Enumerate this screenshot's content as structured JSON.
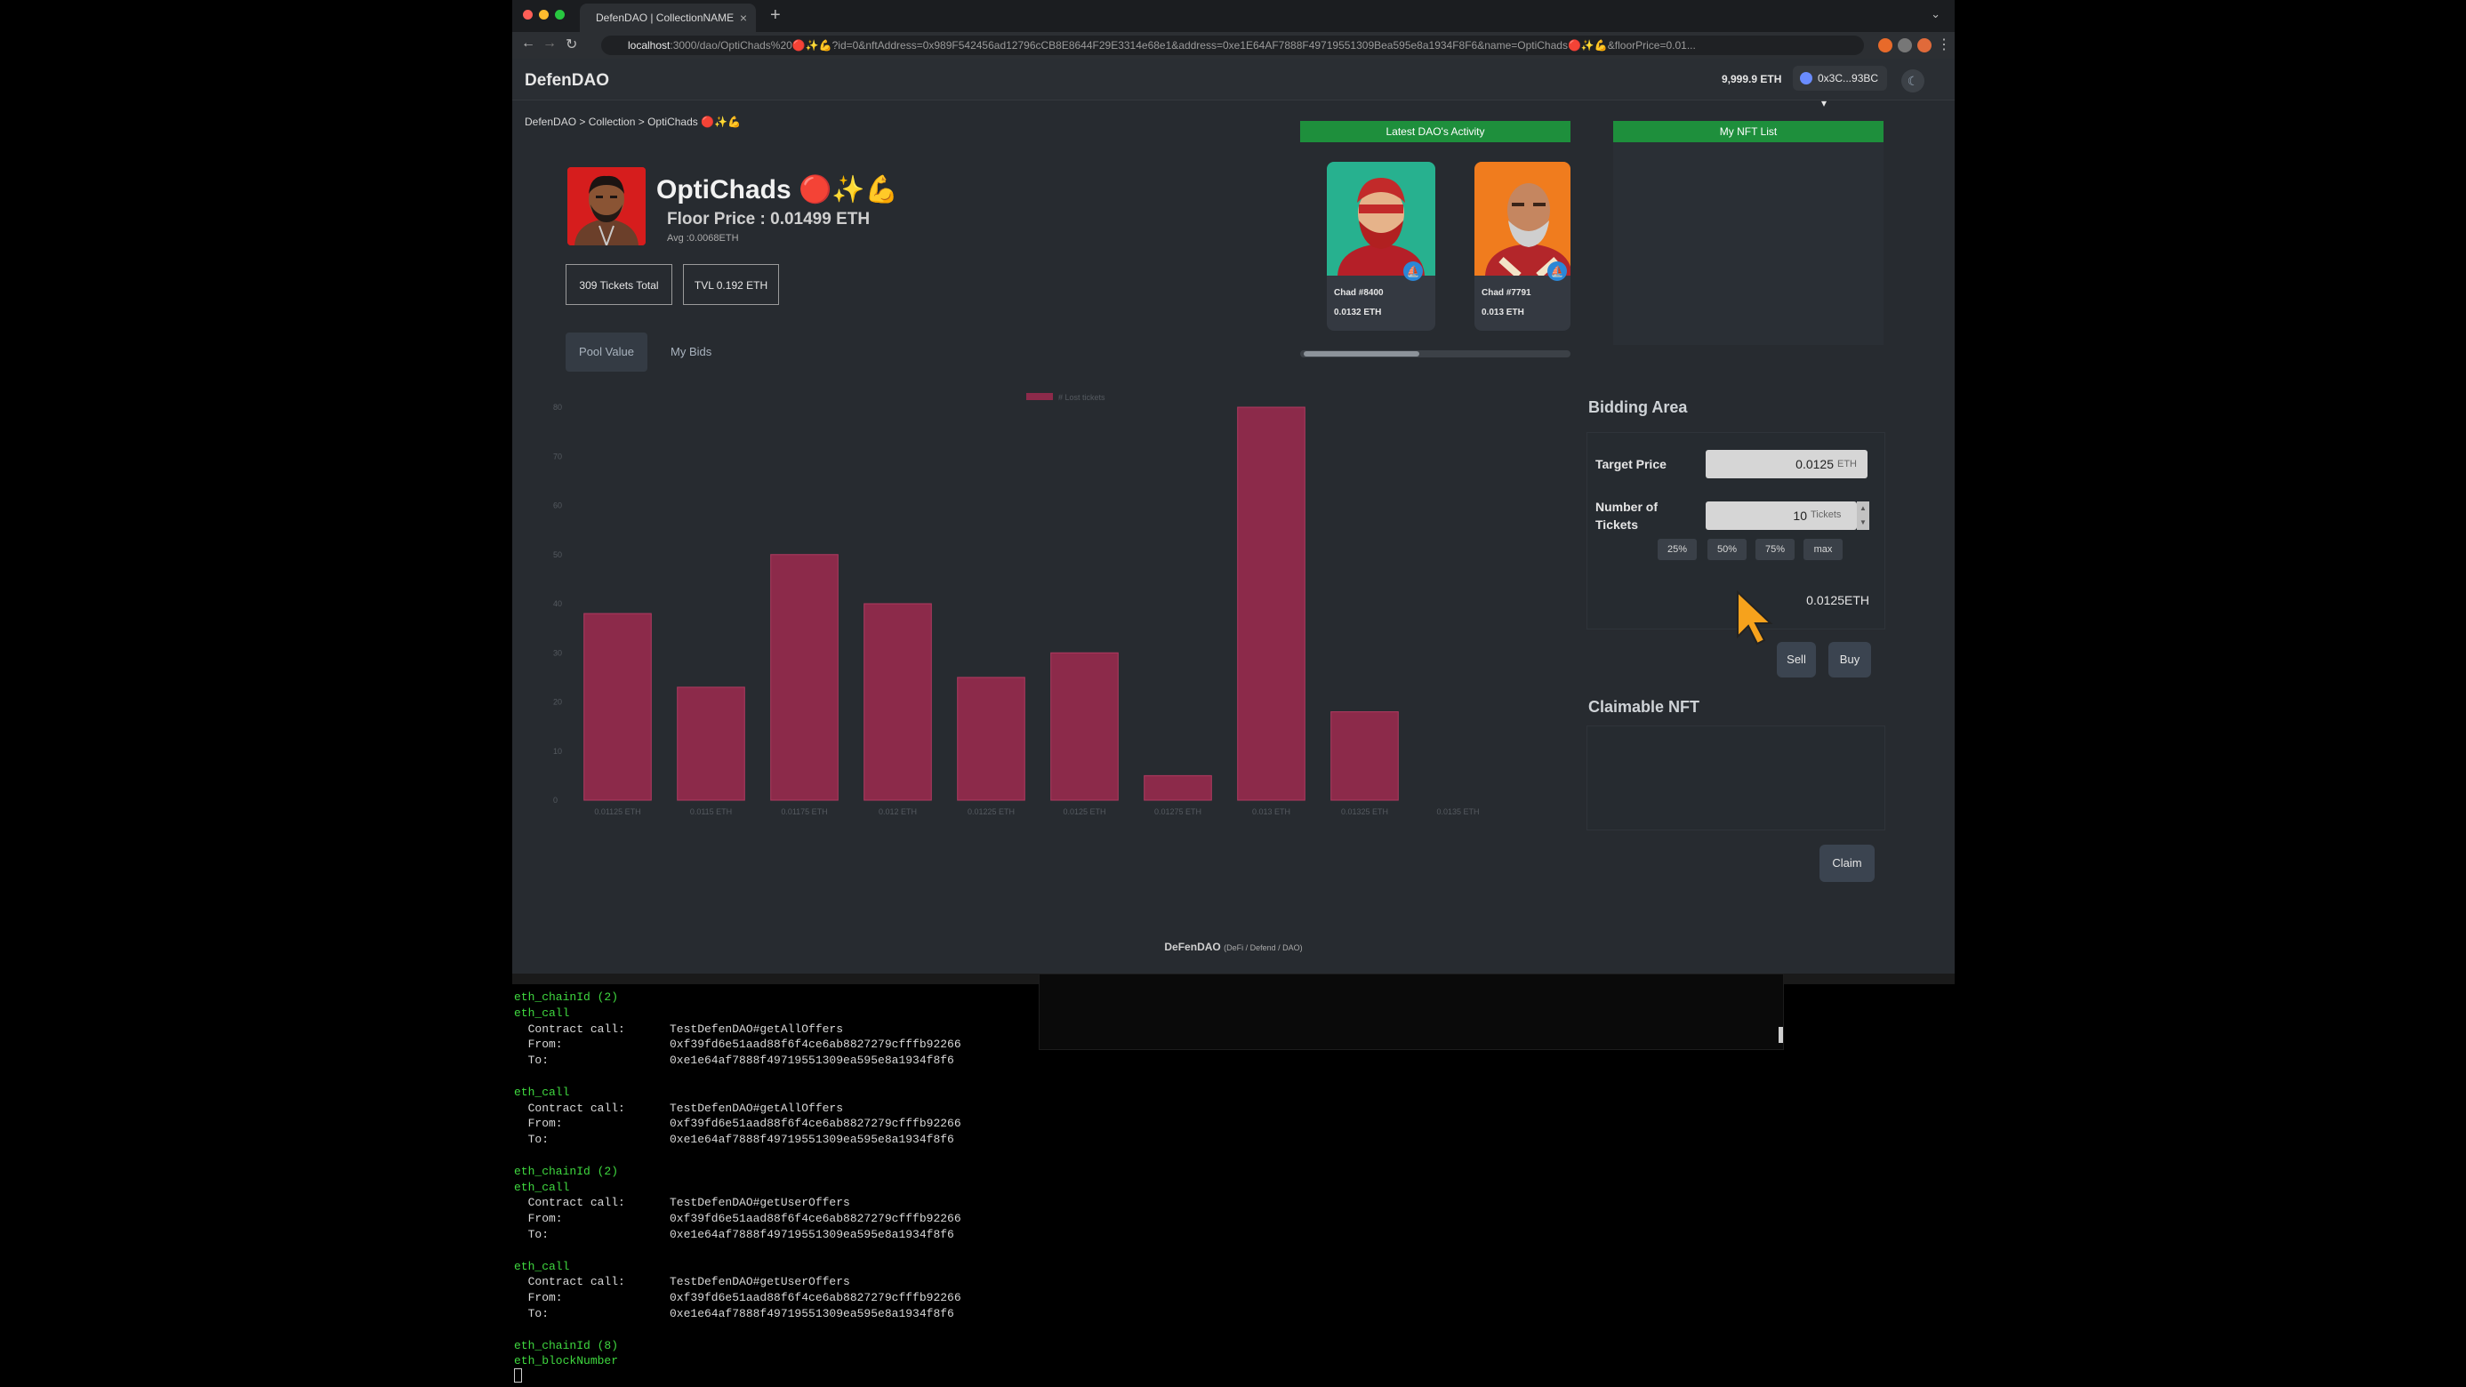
{
  "browser": {
    "tab_title": "DefenDAO | CollectionNAME",
    "url_host": "localhost",
    "url_rest": ":3000/dao/OptiChads%20🔴✨💪?id=0&nftAddress=0x989F542456ad12796cCB8E8644F29E3314e68e1&address=0xe1E64AF7888F49719551309Bea595e8a1934F8F6&name=OptiChads🔴✨💪&floorPrice=0.01..."
  },
  "header": {
    "logo": "DefenDAO",
    "balance": "9,999.9 ETH",
    "wallet": "0x3C...93BC"
  },
  "breadcrumb": "DefenDAO > Collection > OptiChads 🔴✨💪",
  "collection": {
    "name": "OptiChads 🔴✨💪",
    "floor_price": "Floor Price : 0.01499 ETH",
    "avg": "Avg :0.0068ETH",
    "tickets_total": "309 Tickets Total",
    "tvl": "TVL 0.192 ETH"
  },
  "tabs": [
    "Pool Value",
    "My Bids"
  ],
  "activity": {
    "title": "Latest DAO's Activity",
    "items": [
      {
        "name": "Chad #8400",
        "price": "0.0132 ETH"
      },
      {
        "name": "Chad #7791",
        "price": "0.013 ETH"
      }
    ]
  },
  "nft_list": {
    "title": "My NFT List"
  },
  "chart_data": {
    "type": "bar",
    "legend": [
      "# Lost tickets"
    ],
    "categories": [
      "0.01125 ETH",
      "0.0115 ETH",
      "0.01175 ETH",
      "0.012 ETH",
      "0.01225 ETH",
      "0.0125 ETH",
      "0.01275 ETH",
      "0.013 ETH",
      "0.01325 ETH",
      "0.0135 ETH"
    ],
    "series": [
      {
        "name": "# Lost tickets",
        "values": [
          38,
          23,
          50,
          40,
          25,
          30,
          5,
          80,
          18,
          0
        ]
      }
    ],
    "y_ticks": [
      0,
      10,
      20,
      30,
      40,
      50,
      60,
      70,
      80
    ],
    "ylim": [
      0,
      80
    ],
    "grid": false,
    "colors": {
      "bar": "#8c2a4a",
      "bar_border": "#b03a60",
      "text": "#555a60"
    }
  },
  "bidding": {
    "title": "Bidding Area",
    "target_label": "Target Price",
    "target_value": "0.0125",
    "target_unit": "ETH",
    "tickets_label": "Number of Tickets",
    "tickets_value": "10",
    "tickets_unit": "Tickets",
    "pct_buttons": [
      "25%",
      "50%",
      "75%",
      "max"
    ],
    "total": "0.0125ETH",
    "sell": "Sell",
    "buy": "Buy"
  },
  "claim": {
    "title": "Claimable NFT",
    "button": "Claim"
  },
  "footer": {
    "title": "DeFenDAO",
    "subtitle": "(DeFi / Defend / DAO)"
  },
  "terminal": {
    "lines": [
      {
        "type": "green",
        "text": "eth_chainId (2)"
      },
      {
        "type": "green",
        "text": "eth_call"
      },
      {
        "type": "kv",
        "k": "  Contract call:",
        "v": "TestDefenDAO#getAllOffers"
      },
      {
        "type": "kv",
        "k": "  From:",
        "v": "0xf39fd6e51aad88f6f4ce6ab8827279cfffb92266"
      },
      {
        "type": "kv",
        "k": "  To:",
        "v": "0xe1e64af7888f49719551309ea595e8a1934f8f6"
      },
      {
        "type": "blank",
        "text": ""
      },
      {
        "type": "green",
        "text": "eth_call"
      },
      {
        "type": "kv",
        "k": "  Contract call:",
        "v": "TestDefenDAO#getAllOffers"
      },
      {
        "type": "kv",
        "k": "  From:",
        "v": "0xf39fd6e51aad88f6f4ce6ab8827279cfffb92266"
      },
      {
        "type": "kv",
        "k": "  To:",
        "v": "0xe1e64af7888f49719551309ea595e8a1934f8f6"
      },
      {
        "type": "blank",
        "text": ""
      },
      {
        "type": "green",
        "text": "eth_chainId (2)"
      },
      {
        "type": "green",
        "text": "eth_call"
      },
      {
        "type": "kv",
        "k": "  Contract call:",
        "v": "TestDefenDAO#getUserOffers"
      },
      {
        "type": "kv",
        "k": "  From:",
        "v": "0xf39fd6e51aad88f6f4ce6ab8827279cfffb92266"
      },
      {
        "type": "kv",
        "k": "  To:",
        "v": "0xe1e64af7888f49719551309ea595e8a1934f8f6"
      },
      {
        "type": "blank",
        "text": ""
      },
      {
        "type": "green",
        "text": "eth_call"
      },
      {
        "type": "kv",
        "k": "  Contract call:",
        "v": "TestDefenDAO#getUserOffers"
      },
      {
        "type": "kv",
        "k": "  From:",
        "v": "0xf39fd6e51aad88f6f4ce6ab8827279cfffb92266"
      },
      {
        "type": "kv",
        "k": "  To:",
        "v": "0xe1e64af7888f49719551309ea595e8a1934f8f6"
      },
      {
        "type": "blank",
        "text": ""
      },
      {
        "type": "green",
        "text": "eth_chainId (8)"
      },
      {
        "type": "green",
        "text": "eth_blockNumber"
      }
    ]
  }
}
